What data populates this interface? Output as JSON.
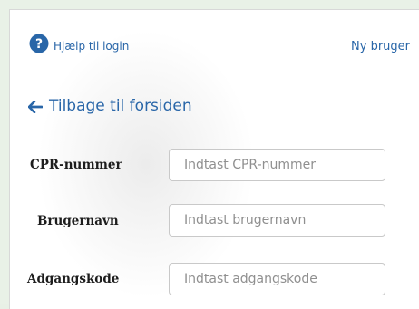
{
  "header": {
    "help_label": "Hjælp til login",
    "new_user_label": "Ny bruger"
  },
  "nav": {
    "back_label": "Tilbage til forsiden"
  },
  "form": {
    "fields": [
      {
        "label": "CPR-nummer",
        "placeholder": "Indtast CPR-nummer",
        "value": ""
      },
      {
        "label": "Brugernavn",
        "placeholder": "Indtast brugernavn",
        "value": ""
      },
      {
        "label": "Adgangskode",
        "placeholder": "Indtast adgangskode",
        "value": ""
      }
    ]
  },
  "icons": {
    "help": "question-circle-icon",
    "back": "arrow-left-icon"
  },
  "colors": {
    "link": "#2966a8",
    "help_icon": "#2966a8",
    "background": "#e9f1e7",
    "panel": "#ffffff"
  }
}
